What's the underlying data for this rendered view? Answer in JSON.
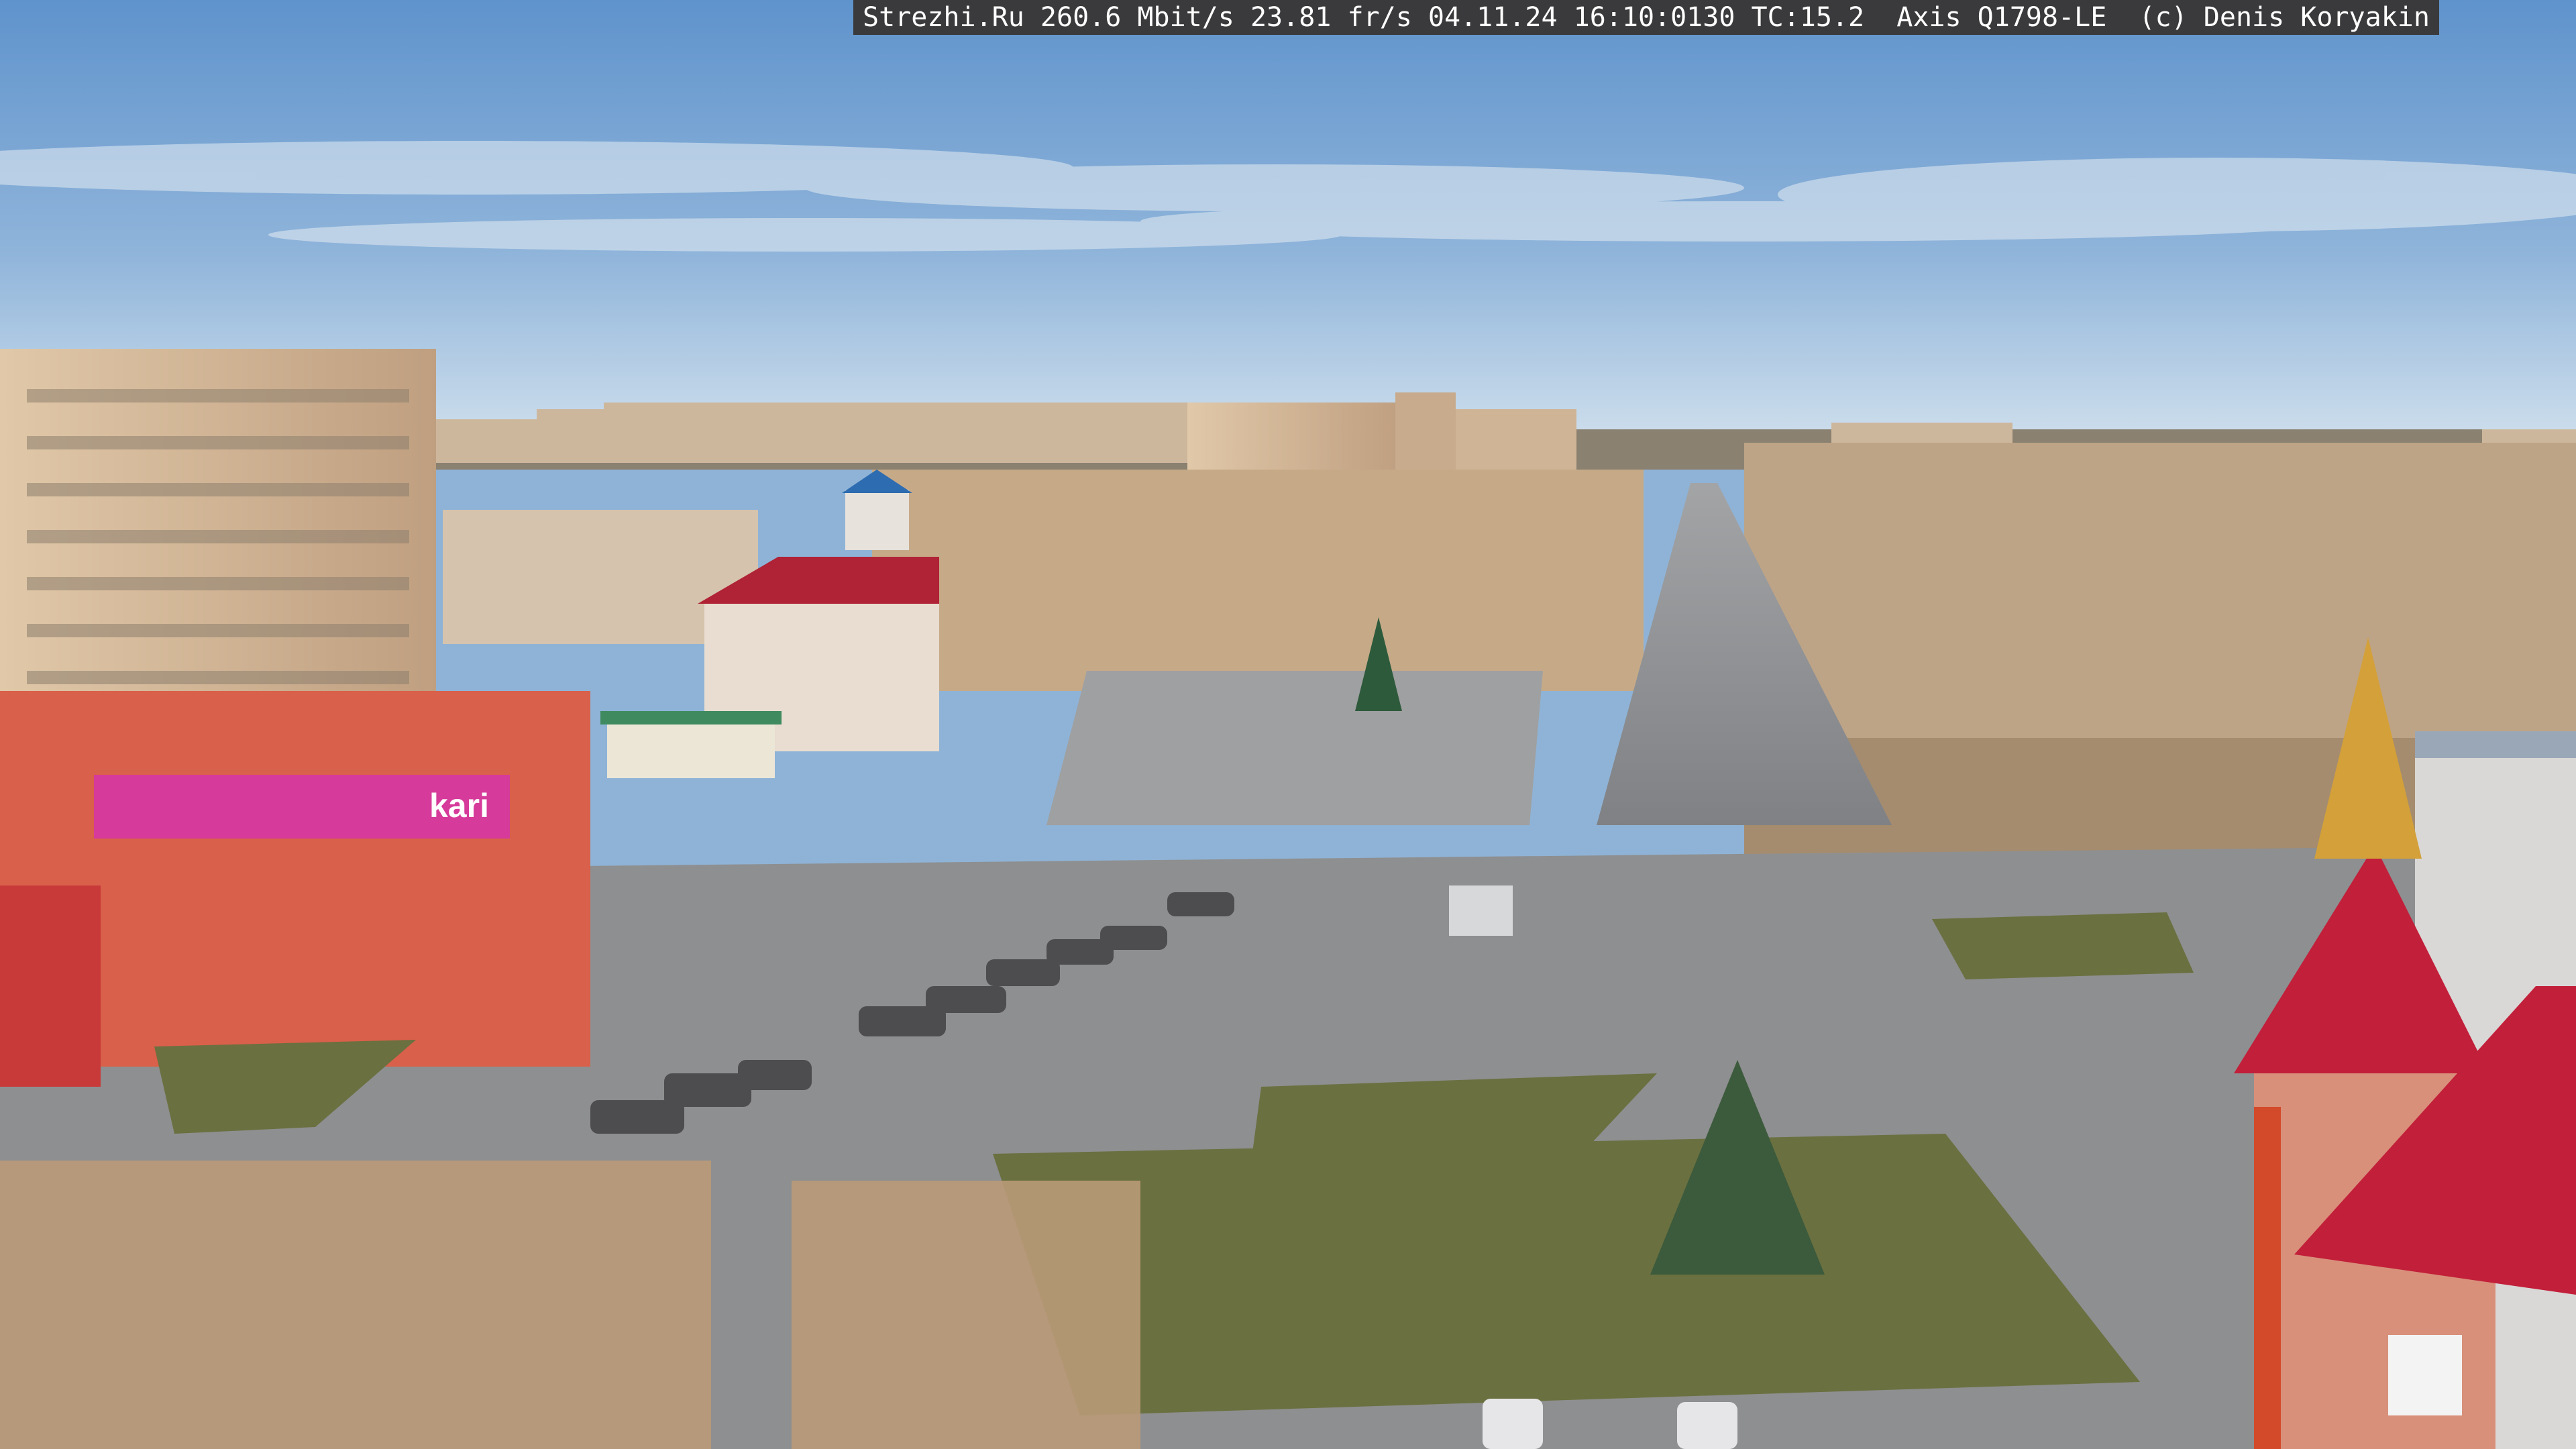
{
  "overlay": {
    "caption": "Strezhi.Ru 260.6 Mbit/s 23.81 fr/s 04.11.24 16:10:0130 TC:15.2  Axis Q1798-LE  (c) Denis Koryakin"
  },
  "signage": {
    "store_logo": "kari"
  },
  "colors": {
    "sky_top": "#5f93cc",
    "sky_horizon": "#c9dcec",
    "building_panel": "#d2b79b",
    "store_facade": "#d9604a",
    "store_banner": "#d63a9a",
    "red_roof": "#c21f3a",
    "asphalt": "#8d8f93",
    "grass": "#6a7040",
    "birch": "#c8a67e"
  }
}
